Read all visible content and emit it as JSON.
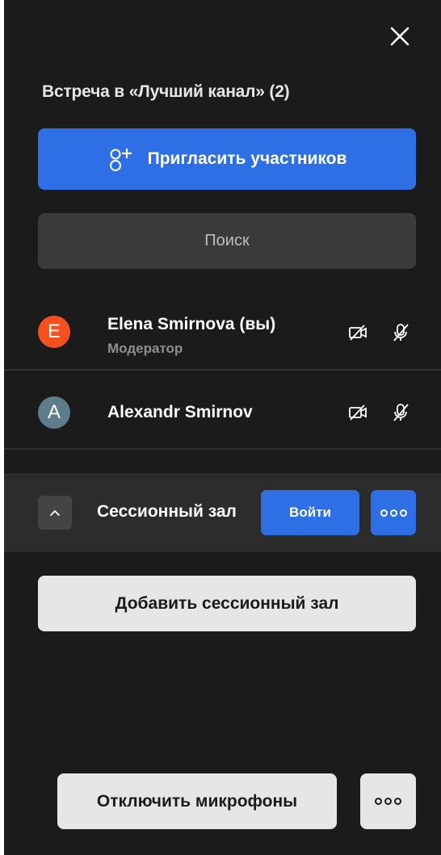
{
  "panel": {
    "title": "Встреча в «Лучший канал» (2)",
    "invite_label": "Пригласить участников",
    "search_placeholder": "Поиск"
  },
  "participants": [
    {
      "initial": "E",
      "name": "Elena Smirnova (вы)",
      "role": "Модератор",
      "avatar_color": "#f4511e"
    },
    {
      "initial": "A",
      "name": "Alexandr Smirnov",
      "role": "",
      "avatar_color": "#5f7c8a"
    }
  ],
  "session_room": {
    "name": "Сессионный зал",
    "join_label": "Войти"
  },
  "add_room_label": "Добавить сессионный зал",
  "footer": {
    "mute_all_label": "Отключить микрофоны"
  },
  "colors": {
    "panel_bg": "#1b1b1b",
    "accent": "#2f6fe6"
  }
}
